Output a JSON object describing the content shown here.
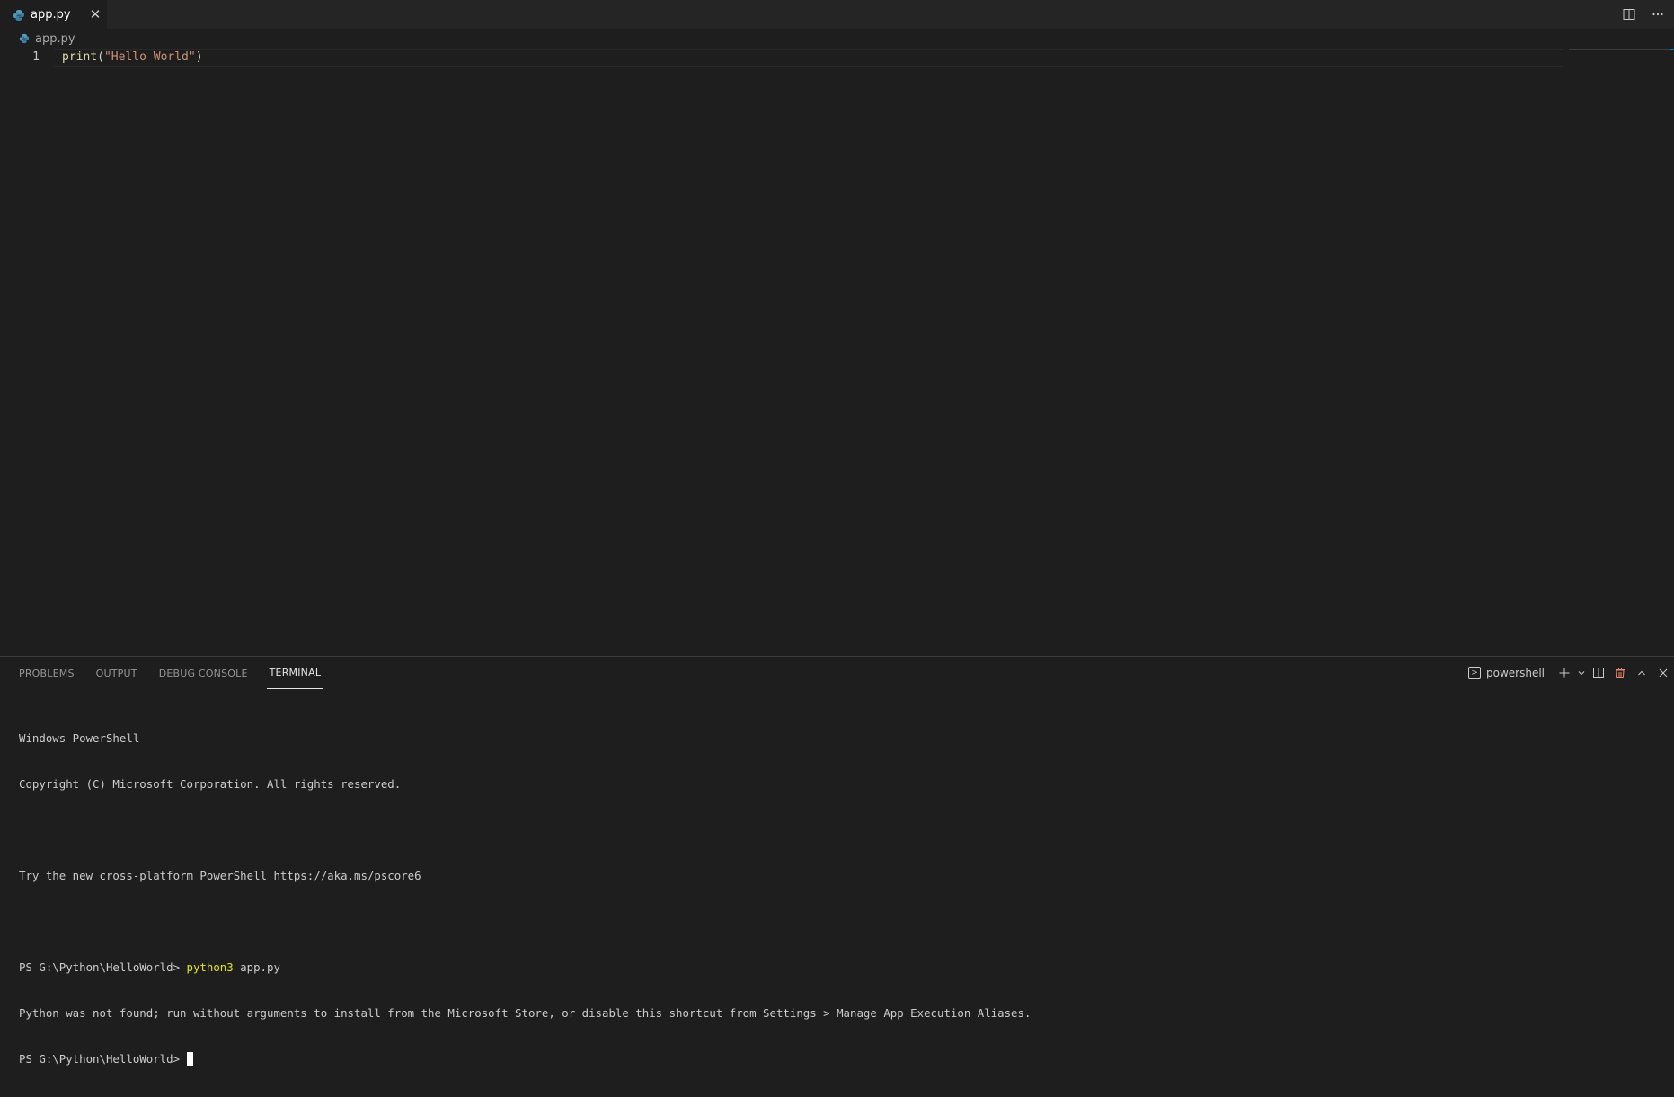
{
  "tab": {
    "label": "app.py",
    "close_glyph": "✕",
    "icon": "python-icon"
  },
  "top_actions": {
    "split_icon": "split-editor-icon",
    "more_icon": "more-actions-icon"
  },
  "breadcrumb": {
    "file": "app.py"
  },
  "editor": {
    "line_number": "1",
    "code": {
      "fn": "print",
      "open": "(",
      "str": "\"Hello World\"",
      "close": ")"
    }
  },
  "panel": {
    "tabs": [
      "PROBLEMS",
      "OUTPUT",
      "DEBUG CONSOLE",
      "TERMINAL"
    ],
    "active_tab": "TERMINAL",
    "shell": "powershell"
  },
  "terminal": {
    "lines": [
      "Windows PowerShell",
      "Copyright (C) Microsoft Corporation. All rights reserved.",
      "",
      "Try the new cross-platform PowerShell https://aka.ms/pscore6",
      ""
    ],
    "prompt1": "PS G:\\Python\\HelloWorld> ",
    "command": "python3",
    "command_arg": " app.py",
    "error": "Python was not found; run without arguments to install from the Microsoft Store, or disable this shortcut from Settings > Manage App Execution Aliases.",
    "prompt2": "PS G:\\Python\\HelloWorld> "
  },
  "colors": {
    "background": "#1e1e1e",
    "tab_bar": "#252526",
    "accent": "#007acc",
    "string": "#ce9178",
    "function": "#dcdcaa",
    "command": "#e5e510"
  }
}
